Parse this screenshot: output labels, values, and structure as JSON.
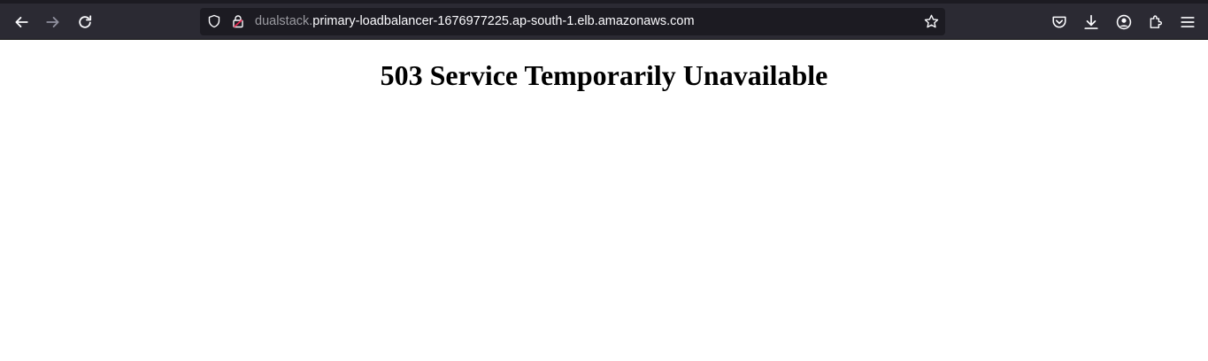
{
  "browser": {
    "url": {
      "prefix": "dualstack.",
      "domain": "primary-loadbalancer-1676977225.ap-south-1.elb.amazonaws.com"
    },
    "icons": {
      "back": "back-arrow-icon",
      "forward": "forward-arrow-icon",
      "reload": "reload-icon",
      "tracking": "shield-icon",
      "security": "lock-warning-icon",
      "bookmark": "star-icon",
      "pocket": "pocket-icon",
      "downloads": "download-icon",
      "account": "account-icon",
      "extensions": "puzzle-icon",
      "menu": "hamburger-menu-icon"
    },
    "colors": {
      "toolbar": "#2b2a33",
      "urlbar": "#1c1b22",
      "lock_warning": "#e22850"
    }
  },
  "page": {
    "heading": "503 Service Temporarily Unavailable"
  }
}
